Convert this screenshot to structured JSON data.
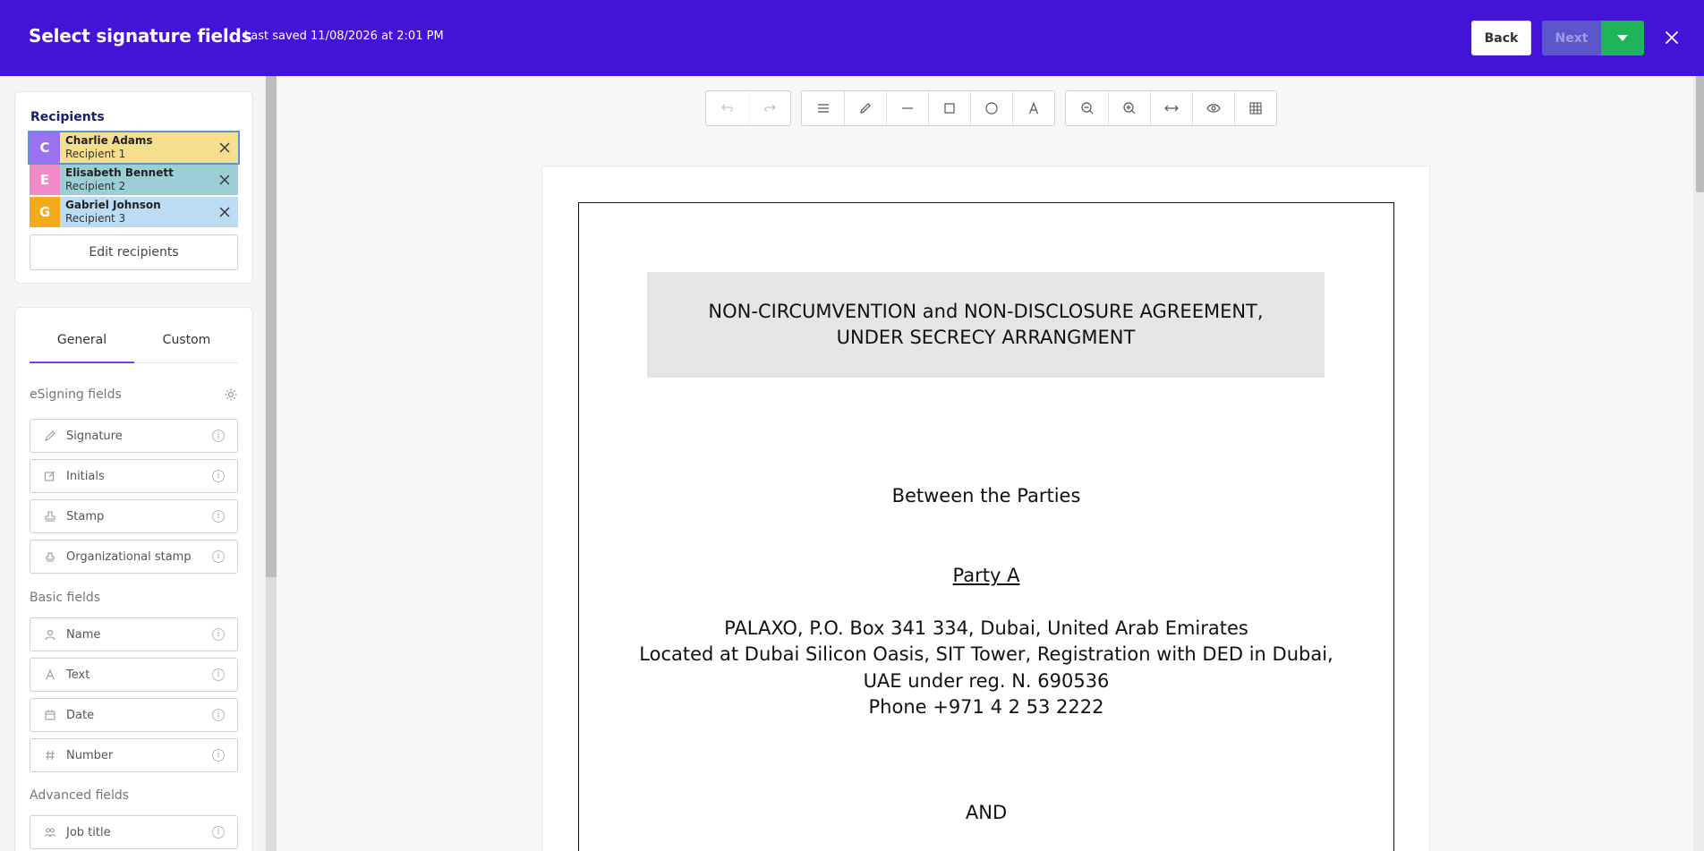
{
  "header": {
    "title": "Select signature fields",
    "last_saved": "Last saved 11/08/2026 at 2:01 PM",
    "back_label": "Back",
    "next_label": "Next",
    "bg_color": "#4413d8"
  },
  "recipients": {
    "title": "Recipients",
    "items": [
      {
        "initial": "C",
        "name": "Charlie Adams",
        "role": "Recipient 1",
        "avatar_color": "#9a72f0",
        "row_color": "#f5df8e"
      },
      {
        "initial": "E",
        "name": "Elisabeth Bennett",
        "role": "Recipient 2",
        "avatar_color": "#f08ac8",
        "row_color": "#9cced6"
      },
      {
        "initial": "G",
        "name": "Gabriel Johnson",
        "role": "Recipient 3",
        "avatar_color": "#f5aa1a",
        "row_color": "#bcdcf4"
      }
    ],
    "edit_label": "Edit recipients"
  },
  "fields_panel": {
    "tabs": [
      "General",
      "Custom"
    ],
    "active_tab": "General",
    "esigning_label": "eSigning fields",
    "esigning": [
      {
        "label": "Signature",
        "icon": "pen-icon"
      },
      {
        "label": "Initials",
        "icon": "edit-icon"
      },
      {
        "label": "Stamp",
        "icon": "stamp-icon"
      },
      {
        "label": "Organizational stamp",
        "icon": "org-stamp-icon"
      }
    ],
    "basic_label": "Basic fields",
    "basic": [
      {
        "label": "Name",
        "icon": "person-icon"
      },
      {
        "label": "Text",
        "icon": "text-icon"
      },
      {
        "label": "Date",
        "icon": "calendar-icon"
      },
      {
        "label": "Number",
        "icon": "hash-icon"
      }
    ],
    "advanced_label": "Advanced fields",
    "advanced": [
      {
        "label": "Job title",
        "icon": "job-icon"
      }
    ]
  },
  "toolbar": {
    "groups": [
      [
        "undo-icon",
        "redo-icon"
      ],
      [
        "menu-icon",
        "pencil-icon",
        "line-icon",
        "rectangle-icon",
        "circle-icon",
        "text-icon"
      ],
      [
        "zoom-out-icon",
        "zoom-in-icon",
        "fit-width-icon",
        "eye-icon",
        "grid-icon"
      ]
    ]
  },
  "document": {
    "heading_line1": "NON-CIRCUMVENTION and NON-DISCLOSURE AGREEMENT,",
    "heading_line2": "UNDER SECRECY ARRANGMENT",
    "between": "Between the Parties",
    "party_a": "Party A",
    "address_line1": "PALAXO, P.O. Box 341 334, Dubai, United Arab Emirates",
    "address_line2": "Located at Dubai Silicon Oasis, SIT Tower, Registration with DED in Dubai,",
    "address_line3": "UAE under reg. N. 690536",
    "phone": "Phone  +971 4 2 53 2222",
    "and": "AND"
  }
}
